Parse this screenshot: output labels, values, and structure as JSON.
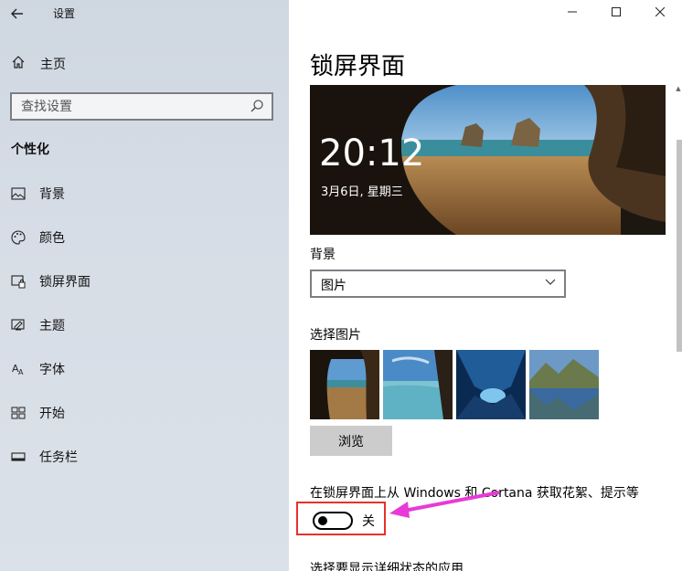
{
  "app": {
    "title": "设置"
  },
  "sidebar": {
    "home_label": "主页",
    "search_placeholder": "查找设置",
    "section": "个性化",
    "items": [
      {
        "label": "背景",
        "icon": "image-icon"
      },
      {
        "label": "颜色",
        "icon": "palette-icon"
      },
      {
        "label": "锁屏界面",
        "icon": "lock-screen-icon"
      },
      {
        "label": "主题",
        "icon": "theme-icon"
      },
      {
        "label": "字体",
        "icon": "font-icon"
      },
      {
        "label": "开始",
        "icon": "start-icon"
      },
      {
        "label": "任务栏",
        "icon": "taskbar-icon"
      }
    ]
  },
  "main": {
    "title": "锁屏界面",
    "preview": {
      "time": "20:12",
      "date": "3月6日, 星期三"
    },
    "background_label": "背景",
    "background_value": "图片",
    "choose_label": "选择图片",
    "browse_label": "浏览",
    "get_fun_facts_label": "在锁屏界面上从 Windows 和 Cortana 获取花絮、提示等",
    "toggle_state": "关",
    "detail_status_label": "选择要显示详细状态的应用"
  },
  "colors": {
    "highlight": "#e8302b",
    "arrow": "#e83ad8"
  }
}
